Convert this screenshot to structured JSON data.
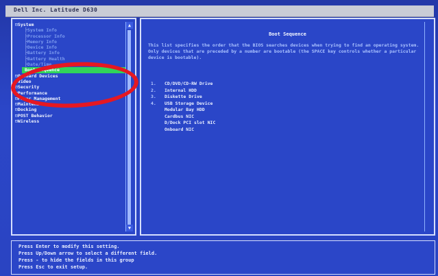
{
  "title": "Dell Inc. Latitude D630",
  "left_tree": [
    {
      "label": "System",
      "kind": "top"
    },
    {
      "label": "System Info",
      "kind": "sub"
    },
    {
      "label": "Processor Info",
      "kind": "sub"
    },
    {
      "label": "Memory Info",
      "kind": "sub"
    },
    {
      "label": "Device Info",
      "kind": "sub"
    },
    {
      "label": "Battery Info",
      "kind": "sub"
    },
    {
      "label": "Battery Health",
      "kind": "sub"
    },
    {
      "label": "Date/Time",
      "kind": "sub"
    },
    {
      "label": "Boot Sequence",
      "kind": "selected"
    },
    {
      "label": "Onboard Devices",
      "kind": "top"
    },
    {
      "label": "Video",
      "kind": "top"
    },
    {
      "label": "Security",
      "kind": "top"
    },
    {
      "label": "Performance",
      "kind": "top"
    },
    {
      "label": "Power Management",
      "kind": "top"
    },
    {
      "label": "Maintenance",
      "kind": "top"
    },
    {
      "label": "Docking",
      "kind": "top"
    },
    {
      "label": "POST Behavior",
      "kind": "top"
    },
    {
      "label": "Wireless",
      "kind": "top"
    }
  ],
  "right": {
    "heading": "Boot Sequence",
    "description": "This list specifies the order that the BIOS searches devices when trying to find an operating system. Only devices that are preceded by a number are bootable (the SPACE key controls whether a particular device is bootable).",
    "items": [
      {
        "num": "1.",
        "label": "CD/DVD/CD-RW Drive"
      },
      {
        "num": "2.",
        "label": "Internal HDD"
      },
      {
        "num": "3.",
        "label": "Diskette Drive"
      },
      {
        "num": "4.",
        "label": "USB Storage Device"
      },
      {
        "num": "",
        "label": "Modular Bay HDD"
      },
      {
        "num": "",
        "label": "Cardbus NIC"
      },
      {
        "num": "",
        "label": "D/Dock PCI slot NIC"
      },
      {
        "num": "",
        "label": "Onboard NIC"
      }
    ]
  },
  "help_lines": [
    "Press Enter to modify this setting.",
    "Press Up/Down arrow to select a different field.",
    "Press - to hide the fields in this group",
    "Press Esc to exit setup."
  ],
  "colors": {
    "annotation": "#e51822",
    "selection": "#31d45b",
    "panel_bg": "#2a46c8"
  }
}
